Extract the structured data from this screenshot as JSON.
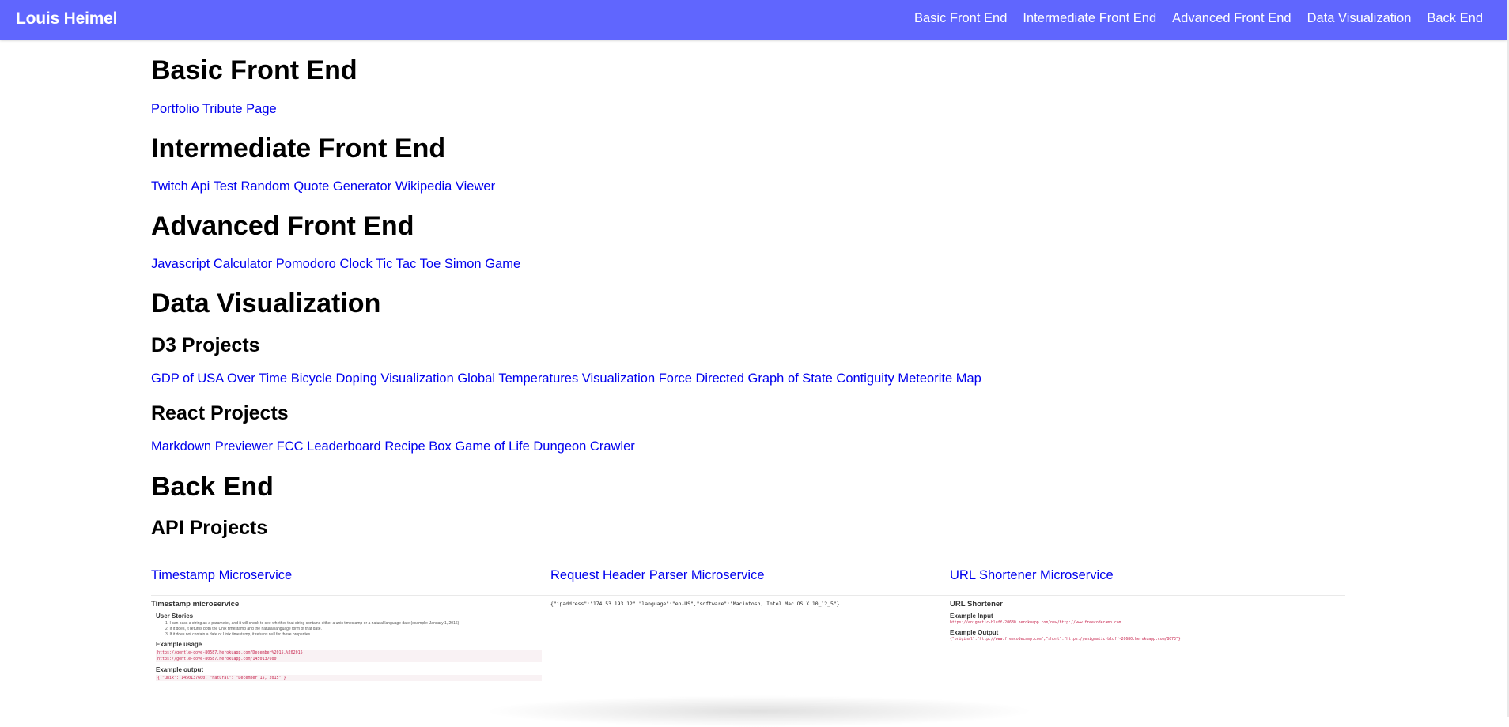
{
  "navbar": {
    "brand": "Louis Heimel",
    "links": [
      "Basic Front End",
      "Intermediate Front End",
      "Advanced Front End",
      "Data Visualization",
      "Back End"
    ],
    "background": "#6066fe"
  },
  "sections": {
    "basic": {
      "title": "Basic Front End",
      "links": [
        "Portfolio",
        "Tribute Page"
      ]
    },
    "intermediate": {
      "title": "Intermediate Front End",
      "links": [
        "Twitch Api Test",
        "Random Quote Generator",
        "Wikipedia Viewer"
      ]
    },
    "advanced": {
      "title": "Advanced Front End",
      "links": [
        "Javascript Calculator",
        "Pomodoro Clock",
        "Tic Tac Toe",
        "Simon Game"
      ]
    },
    "dataviz": {
      "title": "Data Visualization",
      "d3": {
        "title": "D3 Projects",
        "links": [
          "GDP of USA Over Time",
          "Bicycle Doping Visualization",
          "Global Temperatures Visualization",
          "Force Directed Graph of State Contiguity",
          "Meteorite Map"
        ]
      },
      "react": {
        "title": "React Projects",
        "links": [
          "Markdown Previewer",
          "FCC Leaderboard",
          "Recipe Box",
          "Game of Life",
          "Dungeon Crawler"
        ]
      }
    },
    "backend": {
      "title": "Back End",
      "api": {
        "title": "API Projects",
        "projects": [
          "Timestamp Microservice",
          "Request Header Parser Microservice",
          "URL Shortener Microservice"
        ]
      }
    }
  },
  "previews": {
    "timestamp": {
      "title": "Timestamp microservice",
      "user_stories": "User Stories",
      "stories": [
        "1. I can pass a string as a parameter, and it will check to see whether that string contains either a unix timestamp or a natural language date (example: January 1, 2016)",
        "2. If it does, it returns both the Unix timestamp and the natural language form of that date.",
        "3. If it does not contain a date or Unix timestamp, it returns null for those properties."
      ],
      "usage_label": "Example usage",
      "usage": [
        "https://gentle-cove-80587.herokuapp.com/December%2015,%202015",
        "https://gentle-cove-80587.herokuapp.com/1450137600"
      ],
      "output_label": "Example output",
      "output": "{ \"unix\": 1450137600, \"natural\": \"December 15, 2015\" }"
    },
    "header_parser": {
      "json": "{\"ipaddress\":\"174.53.193.12\",\"language\":\"en-US\",\"software\":\"Macintosh; Intel Mac OS X 10_12_5\"}"
    },
    "shortener": {
      "title": "URL Shortener",
      "input_label": "Example Input",
      "input": "https://enigmatic-bluff-20680.herokuapp.com/new/http://www.freecodecamp.com",
      "output_label": "Example Output",
      "output": "{\"original\":\"http://www.freecodecamp.com\",\"short\":\"https://enigmatic-bluff-20680.herokuapp.com/8073\"}"
    }
  }
}
